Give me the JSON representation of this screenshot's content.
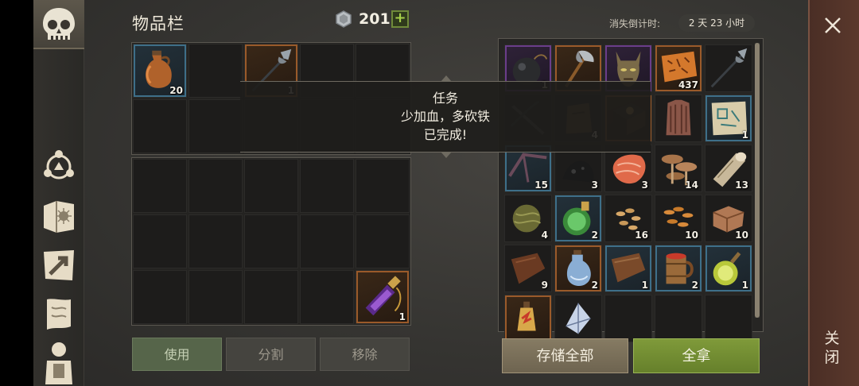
{
  "header": {
    "title": "物品栏",
    "coins": "201",
    "plus_label": "+",
    "timer_label": "消失倒计时:",
    "timer_value": "2 天 23 小时"
  },
  "sidebar": {
    "items": [
      {
        "icon": "skull-icon"
      },
      {
        "icon": "skills-icon"
      },
      {
        "icon": "recipe-book-icon"
      },
      {
        "icon": "crafting-icon"
      },
      {
        "icon": "map-scroll-icon"
      },
      {
        "icon": "character-icon"
      }
    ]
  },
  "inventory": {
    "items": [
      {
        "icon": "jug-icon",
        "qty": "20"
      },
      {
        "icon": "halberd-icon",
        "qty": "1"
      },
      {
        "icon": "purple-potion-icon",
        "qty": "1"
      }
    ]
  },
  "tooltip": {
    "line1": "任务",
    "line2": "少加血，多砍铁",
    "line3": "已完成!"
  },
  "loot": {
    "items": [
      {
        "icon": "bomb-icon",
        "qty": "1"
      },
      {
        "icon": "battle-axe-icon",
        "qty": ""
      },
      {
        "icon": "demon-mask-icon",
        "qty": ""
      },
      {
        "icon": "runic-tablet-icon",
        "qty": "437"
      },
      {
        "icon": "polearm-icon",
        "qty": ""
      },
      {
        "icon": "crossbow-icon",
        "qty": ""
      },
      {
        "icon": "leather-sack-icon",
        "qty": "4"
      },
      {
        "icon": "book-icon",
        "qty": ""
      },
      {
        "icon": "armor-vest-icon",
        "qty": ""
      },
      {
        "icon": "blueprint-scroll-icon",
        "qty": "1"
      },
      {
        "icon": "bow-frame-icon",
        "qty": "15"
      },
      {
        "icon": "coal-icon",
        "qty": "3"
      },
      {
        "icon": "fish-steak-icon",
        "qty": "3"
      },
      {
        "icon": "mushroom-icon",
        "qty": "14"
      },
      {
        "icon": "log-icon",
        "qty": "13"
      },
      {
        "icon": "fiber-ball-icon",
        "qty": "4"
      },
      {
        "icon": "green-flask-icon",
        "qty": "2"
      },
      {
        "icon": "seeds-icon",
        "qty": "16"
      },
      {
        "icon": "grain-icon",
        "qty": "10"
      },
      {
        "icon": "leather-icon",
        "qty": "10"
      },
      {
        "icon": "hide-icon",
        "qty": "9"
      },
      {
        "icon": "blue-potion-icon",
        "qty": "2"
      },
      {
        "icon": "leather-roll-icon",
        "qty": "1"
      },
      {
        "icon": "mug-icon",
        "qty": "2"
      },
      {
        "icon": "yellow-flask-icon",
        "qty": "1"
      },
      {
        "icon": "fire-potion-icon",
        "qty": ""
      },
      {
        "icon": "crystal-shard-icon",
        "qty": ""
      }
    ]
  },
  "buttons": {
    "use": "使用",
    "split": "分割",
    "remove": "移除",
    "store_all": "存储全部",
    "take_all": "全拿",
    "close": "关闭"
  },
  "colors": {
    "accent_green": "#7f9a3a",
    "rarity_blue": "#3e6f89",
    "rarity_orange": "#9a5a2a",
    "rarity_purple": "#6a3d8a",
    "close_panel": "#5a382c"
  }
}
